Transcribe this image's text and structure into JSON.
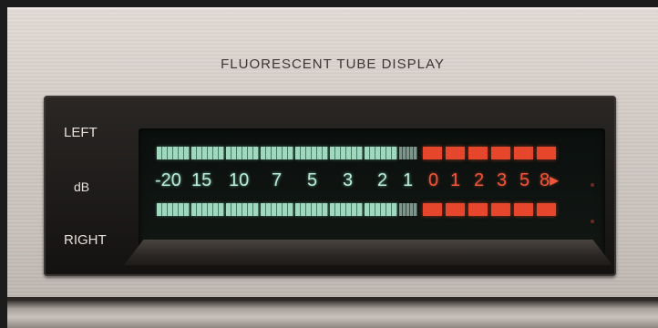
{
  "panel": {
    "title": "FLUORESCENT TUBE DISPLAY"
  },
  "display": {
    "left_label": "LEFT",
    "db_label": "dB",
    "right_label": "RIGHT",
    "scale_green": [
      "-20",
      "15",
      "10",
      "7",
      "5",
      "3",
      "2",
      "1"
    ],
    "scale_red": [
      "0",
      "1",
      "2",
      "3",
      "5",
      "8▸"
    ],
    "colors": {
      "green_segment": "#9fd7bf",
      "red_segment": "#e5462c",
      "bezel": "#1c1a18",
      "panel": "#d2cbc5"
    }
  }
}
